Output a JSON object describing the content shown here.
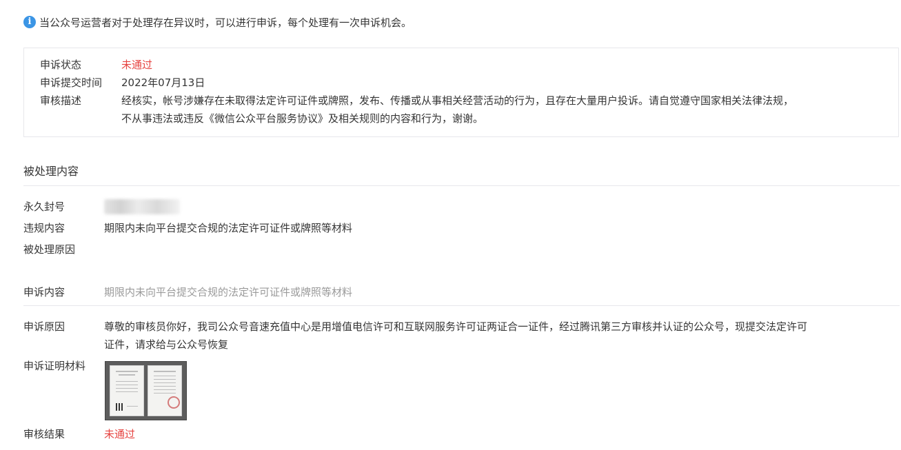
{
  "notice": {
    "icon": "info-icon",
    "text": "当公众号运营者对于处理存在异议时，可以进行申诉，每个处理有一次申诉机会。"
  },
  "status_box": {
    "status_label": "申诉状态",
    "status_value": "未通过",
    "submit_time_label": "申诉提交时间",
    "submit_time_value": "2022年07月13日",
    "review_desc_label": "审核描述",
    "review_desc_line1": "经核实，帐号涉嫌存在未取得法定许可证件或牌照，发布、传播或从事相关经营活动的行为，且存在大量用户投诉。请自觉遵守国家相关法律法规，",
    "review_desc_line2": "不从事违法或违反《微信公众平台服务协议》及相关规则的内容和行为，谢谢。"
  },
  "processed": {
    "section_title": "被处理内容",
    "ban_label": "永久封号",
    "violation_label": "违规内容",
    "violation_value": "期限内未向平台提交合规的法定许可证件或牌照等材料",
    "reason_label": "被处理原因"
  },
  "appeal": {
    "content_label": "申诉内容",
    "content_value": "期限内未向平台提交合规的法定许可证件或牌照等材料",
    "reason_label": "申诉原因",
    "reason_line1": "尊敬的审核员你好，我司公众号音速充值中心是用增值电信许可和互联网服务许可证两证合一证件，经过腾讯第三方审核并认证的公众号，现提交法定许可",
    "reason_line2": "证件，请求给与公众号恢复",
    "evidence_label": "申诉证明材料",
    "result_label": "审核结果",
    "result_value": "未通过"
  },
  "colors": {
    "accent_red": "#e64340",
    "info_blue": "#3b95e5",
    "muted_gray": "#9a9a9a",
    "border": "#e7e7eb"
  }
}
